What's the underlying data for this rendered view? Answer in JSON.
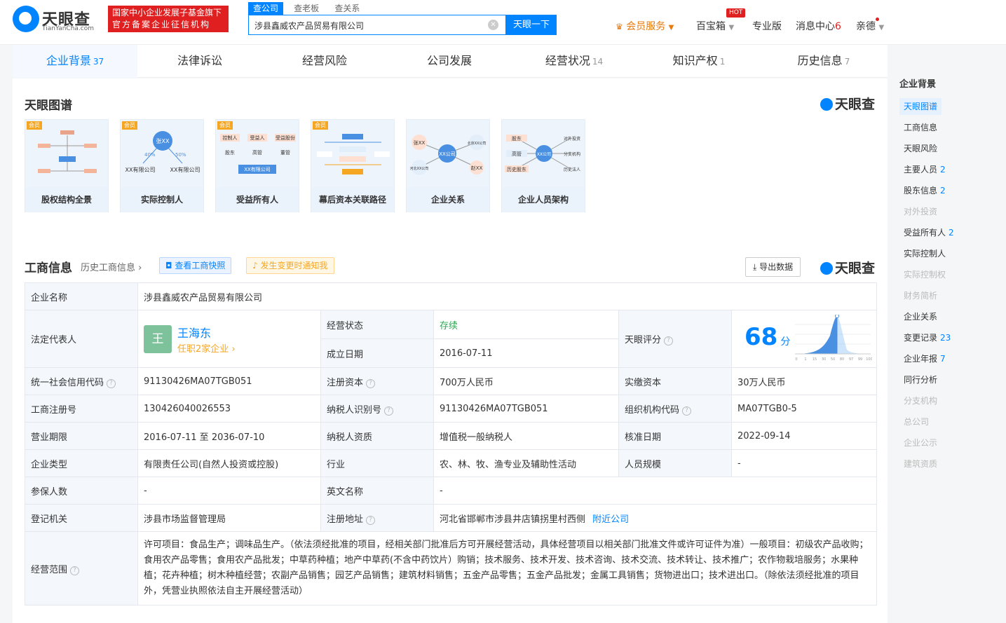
{
  "header": {
    "logo_name": "天眼查",
    "logo_sub": "TianYanCha.com",
    "badge_line1": "国家中小企业发展子基金旗下",
    "badge_line2": "官方备案企业征信机构",
    "search_tabs": [
      "查公司",
      "查老板",
      "查关系"
    ],
    "search_value": "涉县鑫威农产品贸易有限公司",
    "search_button": "天眼一下",
    "nav": {
      "vip": "会员服务",
      "box": "百宝箱",
      "hot": "HOT",
      "pro": "专业版",
      "msg": "消息中心",
      "msg_count": "6",
      "user": "亲德"
    }
  },
  "tabs": [
    {
      "label": "企业背景",
      "count": "37"
    },
    {
      "label": "法律诉讼",
      "count": ""
    },
    {
      "label": "经营风险",
      "count": ""
    },
    {
      "label": "公司发展",
      "count": ""
    },
    {
      "label": "经营状况",
      "count": "14"
    },
    {
      "label": "知识产权",
      "count": "1"
    },
    {
      "label": "历史信息",
      "count": "7"
    }
  ],
  "graph": {
    "title": "天眼图谱",
    "brand": "天眼查",
    "vip_tag": "会员",
    "cards": [
      "股权结构全景",
      "实际控制人",
      "受益所有人",
      "幕后资本关联路径",
      "企业关系",
      "企业人员架构"
    ],
    "card2_nodes": [
      "张XX",
      "XX有限公司",
      "XX有限公司",
      "40%",
      "50%"
    ],
    "card3_nodes": [
      "控制人",
      "受益人",
      "受益股份",
      "股东",
      "高管",
      "董管",
      "XX有限公司"
    ],
    "card5_nodes": [
      "张XX",
      "XX公司",
      "北京XX公司",
      "河北XX公司",
      "赵XX"
    ],
    "card6_nodes": [
      "股东",
      "高管",
      "历史股东",
      "XX公司",
      "对外投资",
      "分支机构",
      "历史法人"
    ]
  },
  "biz": {
    "title": "工商信息",
    "history_link": "历史工商信息",
    "snapshot_btn": "查看工商快照",
    "notify_btn": "发生变更时通知我",
    "export_btn": "导出数据",
    "brand": "天眼查",
    "company_name_k": "企业名称",
    "company_name": "涉县鑫威农产品贸易有限公司",
    "legal_k": "法定代表人",
    "legal_avatar": "王",
    "legal_name": "王海东",
    "legal_sub": "任职2家企业",
    "status_k": "经营状态",
    "status": "存续",
    "found_k": "成立日期",
    "found": "2016-07-11",
    "score_k": "天眼评分",
    "score": "68",
    "score_unit": "分",
    "score_ticks": [
      "0",
      "1",
      "15",
      "30",
      "50",
      "80",
      "97",
      "99",
      "100"
    ],
    "credit_k": "统一社会信用代码",
    "credit": "91130426MA07TGB051",
    "capital_k": "注册资本",
    "capital": "700万人民币",
    "paid_k": "实缴资本",
    "paid": "30万人民币",
    "reg_no_k": "工商注册号",
    "reg_no": "130426040026553",
    "tax_id_k": "纳税人识别号",
    "tax_id": "91130426MA07TGB051",
    "org_code_k": "组织机构代码",
    "org_code": "MA07TGB0-5",
    "term_k": "营业期限",
    "term": "2016-07-11 至 2036-07-10",
    "taxpayer_k": "纳税人资质",
    "taxpayer": "增值税一般纳税人",
    "approve_k": "核准日期",
    "approve": "2022-09-14",
    "type_k": "企业类型",
    "type": "有限责任公司(自然人投资或控股)",
    "industry_k": "行业",
    "industry": "农、林、牧、渔专业及辅助性活动",
    "staff_k": "人员规模",
    "staff": "-",
    "insured_k": "参保人数",
    "insured": "-",
    "en_name_k": "英文名称",
    "en_name": "-",
    "authority_k": "登记机关",
    "authority": "涉县市场监督管理局",
    "address_k": "注册地址",
    "address": "河北省邯郸市涉县井店镇拐里村西侧",
    "nearby": "附近公司",
    "scope_k": "经营范围",
    "scope": "许可项目：食品生产；调味品生产。（依法须经批准的项目，经相关部门批准后方可开展经营活动，具体经营项目以相关部门批准文件或许可证件为准）一般项目：初级农产品收购；食用农产品零售；食用农产品批发；中草药种植；地产中草药(不含中药饮片）购销；技术服务、技术开发、技术咨询、技术交流、技术转让、技术推广；农作物栽培服务；水果种植；花卉种植；树木种植经营；农副产品销售；园艺产品销售；建筑材料销售；五金产品零售；五金产品批发；金属工具销售；货物进出口；技术进出口。（除依法须经批准的项目外，凭营业执照依法自主开展经营活动）"
  },
  "sidebar": {
    "title": "企业背景",
    "items": [
      {
        "label": "天眼图谱",
        "count": "",
        "state": "active"
      },
      {
        "label": "工商信息",
        "count": "",
        "state": ""
      },
      {
        "label": "天眼风险",
        "count": "",
        "state": ""
      },
      {
        "label": "主要人员",
        "count": "2",
        "state": ""
      },
      {
        "label": "股东信息",
        "count": "2",
        "state": ""
      },
      {
        "label": "对外投资",
        "count": "",
        "state": "disabled"
      },
      {
        "label": "受益所有人",
        "count": "2",
        "state": ""
      },
      {
        "label": "实际控制人",
        "count": "",
        "state": ""
      },
      {
        "label": "实际控制权",
        "count": "",
        "state": "disabled"
      },
      {
        "label": "财务简析",
        "count": "",
        "state": "disabled"
      },
      {
        "label": "企业关系",
        "count": "",
        "state": ""
      },
      {
        "label": "变更记录",
        "count": "23",
        "state": ""
      },
      {
        "label": "企业年报",
        "count": "7",
        "state": ""
      },
      {
        "label": "同行分析",
        "count": "",
        "state": ""
      },
      {
        "label": "分支机构",
        "count": "",
        "state": "disabled"
      },
      {
        "label": "总公司",
        "count": "",
        "state": "disabled"
      },
      {
        "label": "企业公示",
        "count": "",
        "state": "disabled"
      },
      {
        "label": "建筑资质",
        "count": "",
        "state": "disabled"
      }
    ]
  }
}
